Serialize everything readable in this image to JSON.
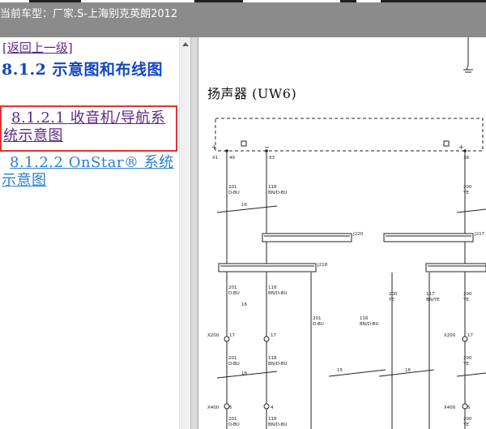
{
  "header": {
    "title": "当前车型：厂家.S-上海别克英朗2012"
  },
  "nav": {
    "back_link": "[返回上一级]",
    "section_heading": "8.1.2 示意图和布线图",
    "items": [
      {
        "label": "8.1.2.1 收音机/导航系统示意图",
        "active": true
      },
      {
        "label": "8.1.2.2 OnStar® 系统示意图",
        "active": false
      }
    ]
  },
  "diagram": {
    "title": "扬声器 (UW6)",
    "top_terminal_label": "X1",
    "connector_labels": [
      "J220",
      "J217",
      "J218"
    ],
    "harness_labels": [
      "X200",
      "X400"
    ],
    "pins": [
      "40",
      "33",
      "38",
      "17",
      "5",
      "4"
    ],
    "wires": [
      {
        "circuit": "201",
        "color": "D-BU"
      },
      {
        "circuit": "118",
        "color": "BN/D-BU"
      },
      {
        "circuit": "200",
        "color": "YE"
      },
      {
        "circuit": "117",
        "color": "BN/YE"
      },
      {
        "circuit": "116",
        "color": "BN/D-BU"
      }
    ],
    "gauge_labels": [
      "16",
      "15"
    ]
  },
  "colors": {
    "active_outline": "#e23333",
    "visited_link": "#5b2a86",
    "link": "#2a7fd4",
    "heading": "#1346c6",
    "titlebar": "#8b8b8b"
  }
}
